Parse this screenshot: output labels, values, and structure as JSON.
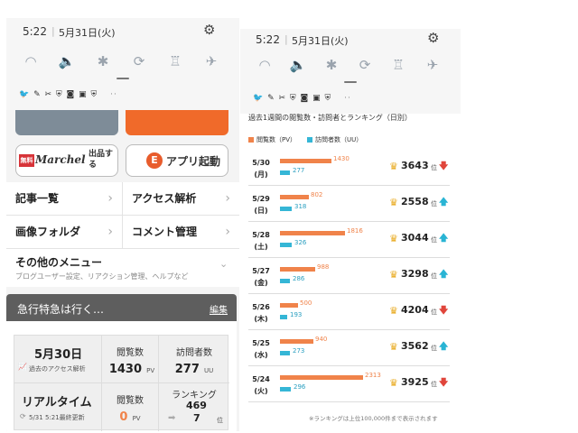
{
  "left": {
    "status": {
      "time": "5:22",
      "date": "5月31日(火)"
    },
    "quick_icons": [
      "wifi-icon",
      "volume-icon",
      "bluetooth-icon",
      "auto-rotate-icon",
      "flashlight-icon",
      "airplane-icon"
    ],
    "notif_icons": "🐦 ✎ ✂ ⛨ ◙ ▣ ⛨",
    "notif_more": "··",
    "marchel": {
      "badge": "無料",
      "name": "Marchel",
      "sub1": "出品す",
      "sub2": "る"
    },
    "app_launch": "アプリ起動",
    "menu": {
      "article_list": "記事一覧",
      "access_analysis": "アクセス解析",
      "image_folder": "画像フォルダ",
      "comment_mgmt": "コメント管理",
      "other_menu": "その他のメニュー",
      "other_menu_sub": "ブログユーザー設定、リアクション管理、ヘルプなど"
    },
    "blog": {
      "name": "急行特急は行く…",
      "edit": "編集",
      "day_date": "5月30日",
      "past_access": "過去のアクセス解析",
      "pv_label": "閲覧数",
      "pv_value": "1430",
      "pv_unit": "PV",
      "uu_label": "訪問者数",
      "uu_value": "277",
      "uu_unit": "UU",
      "realtime": "リアルタイム",
      "realtime_updated": "5/31 5:21最終更新",
      "rt_pv_label": "閲覧数",
      "rt_pv_value": "0",
      "rt_pv_unit": "PV",
      "ranking_label": "ランキング",
      "ranking_value": "469",
      "ranking_sub": "7",
      "ranking_unit": "位"
    }
  },
  "right": {
    "status": {
      "time": "5:22",
      "date": "5月31日(火)"
    },
    "notif_icons": "🐦 ✎ ✂ ⛨ ◙ ▣ ⛨",
    "notif_more": "··",
    "title": "過去1週間の閲覧数・訪問者とランキング（日別）",
    "legend": {
      "pv": "閲覧数（PV）",
      "uu": "訪問者数（UU）"
    },
    "rank_unit": "位",
    "footnote": "※ランキングは上位100,000件まで表示されます",
    "colors": {
      "pv": "#f0834a",
      "uu": "#35b6d6",
      "up": "#29b4d4",
      "down": "#e0453b",
      "crown": "#e8a81a"
    }
  },
  "chart_data": {
    "type": "bar",
    "categories": [
      "5/30 (月)",
      "5/29 (日)",
      "5/28 (土)",
      "5/27 (金)",
      "5/26 (木)",
      "5/25 (水)",
      "5/24 (火)"
    ],
    "days": [
      {
        "date": "5/30",
        "weekday": "(月)",
        "pv": 1430,
        "uu": 277,
        "rank": 3643,
        "trend": "down"
      },
      {
        "date": "5/29",
        "weekday": "(日)",
        "pv": 802,
        "uu": 318,
        "rank": 2558,
        "trend": "up"
      },
      {
        "date": "5/28",
        "weekday": "(土)",
        "pv": 1816,
        "uu": 326,
        "rank": 3044,
        "trend": "up"
      },
      {
        "date": "5/27",
        "weekday": "(金)",
        "pv": 988,
        "uu": 286,
        "rank": 3298,
        "trend": "up"
      },
      {
        "date": "5/26",
        "weekday": "(木)",
        "pv": 500,
        "uu": 193,
        "rank": 4204,
        "trend": "down"
      },
      {
        "date": "5/25",
        "weekday": "(水)",
        "pv": 940,
        "uu": 273,
        "rank": 3562,
        "trend": "up"
      },
      {
        "date": "5/24",
        "weekday": "(火)",
        "pv": 2313,
        "uu": 296,
        "rank": 3925,
        "trend": "down"
      }
    ],
    "series": [
      {
        "name": "閲覧数（PV）",
        "values": [
          1430,
          802,
          1816,
          988,
          500,
          940,
          2313
        ]
      },
      {
        "name": "訪問者数（UU）",
        "values": [
          277,
          318,
          326,
          286,
          193,
          273,
          296
        ]
      }
    ],
    "title": "過去1週間の閲覧数・訪問者とランキング（日別）"
  }
}
